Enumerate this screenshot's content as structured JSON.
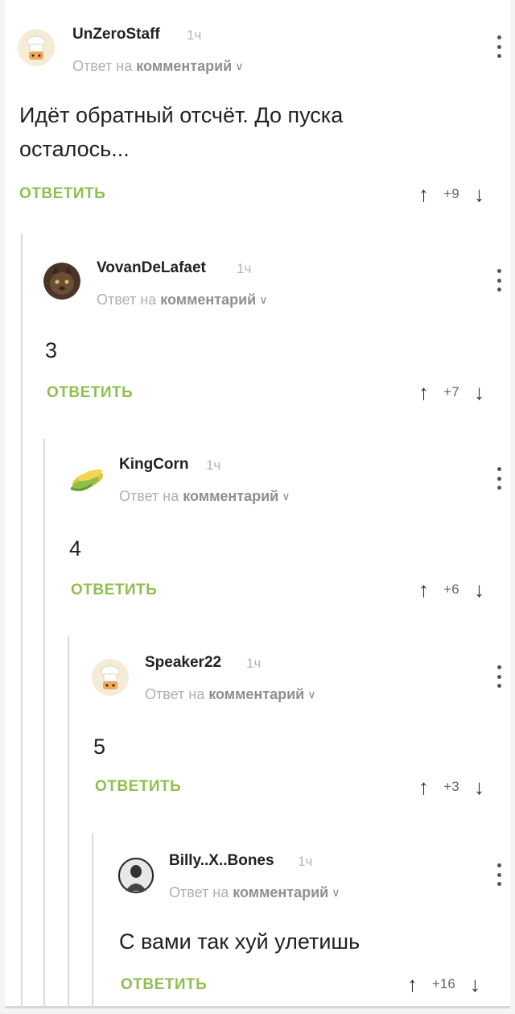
{
  "reply_to_prefix": "Ответ на",
  "reply_to_target": "комментарий",
  "reply_label": "ОТВЕТИТЬ",
  "comments": [
    {
      "username": "UnZeroStaff",
      "time": "1ч",
      "text": "Идёт обратный отсчёт. До пуска осталось...",
      "score": "+9",
      "avatar": "chef-hat-avatar"
    },
    {
      "username": "VovanDeLafaet",
      "time": "1ч",
      "text": "3",
      "score": "+7",
      "avatar": "cat-avatar"
    },
    {
      "username": "KingCorn",
      "time": "1ч",
      "text": "4",
      "score": "+6",
      "avatar": "corn-avatar"
    },
    {
      "username": "Speaker22",
      "time": "1ч",
      "text": "5",
      "score": "+3",
      "avatar": "chef-hat-avatar"
    },
    {
      "username": "Billy..X..Bones",
      "time": "1ч",
      "text": "С вами так хуй улетишь",
      "score": "+16",
      "avatar": "portrait-avatar"
    }
  ],
  "colors": {
    "accent": "#8fbf4f",
    "thread_line": "#d9d9d9"
  }
}
